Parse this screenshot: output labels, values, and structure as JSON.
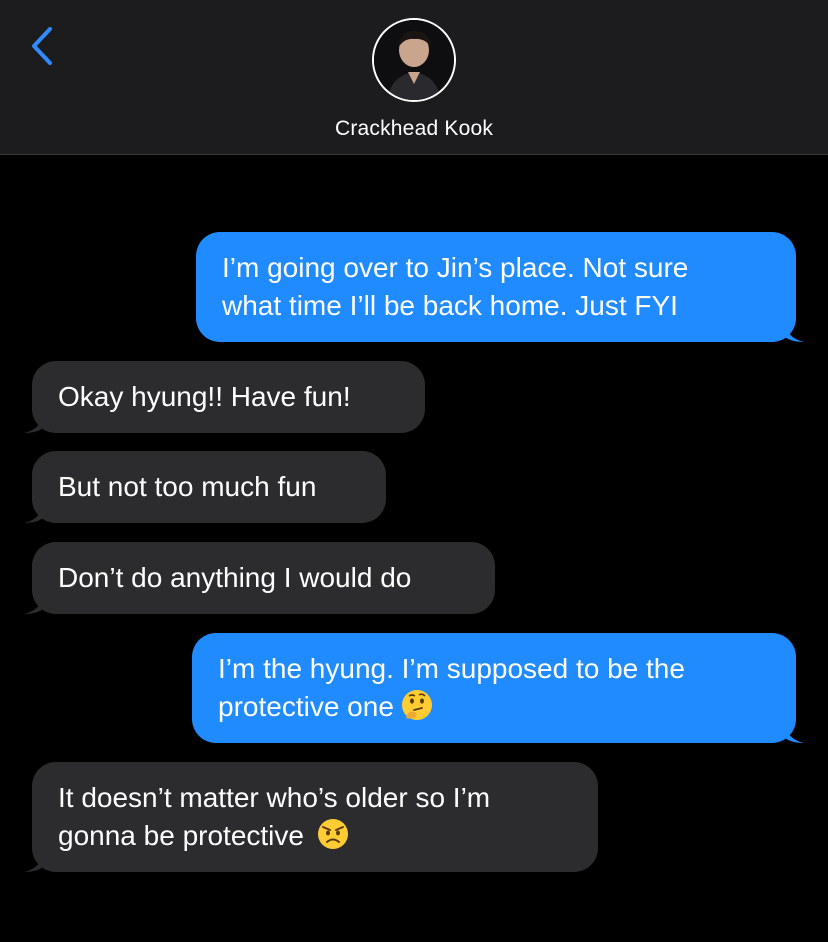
{
  "header": {
    "contact_name": "Crackhead Kook",
    "back_icon": "chevron-left-icon",
    "avatar_icon": "contact-avatar"
  },
  "colors": {
    "sent_bubble": "#1f8bff",
    "received_bubble": "#2c2c2e",
    "background": "#000000",
    "header_bg": "#1c1c1e",
    "accent": "#2f8cff"
  },
  "messages": [
    {
      "direction": "sent",
      "lines": [
        "I’m going over to Jin’s place. Not sure",
        "what time I’ll be back home. Just FYI"
      ]
    },
    {
      "direction": "received",
      "lines": [
        "Okay hyung!! Have fun!"
      ]
    },
    {
      "direction": "received",
      "lines": [
        "But not too much fun"
      ]
    },
    {
      "direction": "received",
      "lines": [
        "Don’t do anything I would do"
      ]
    },
    {
      "direction": "sent",
      "lines": [
        "I’m the hyung. I’m supposed to be the",
        "protective one"
      ],
      "emoji": "thinking-face-emoji"
    },
    {
      "direction": "received",
      "lines": [
        "It doesn’t matter who’s older so I’m",
        "gonna be protective"
      ],
      "emoji": "angry-face-emoji"
    }
  ]
}
